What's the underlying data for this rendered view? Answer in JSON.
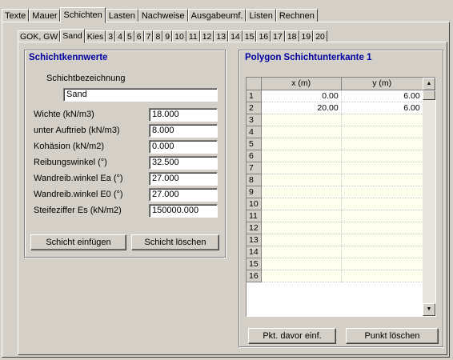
{
  "top_tabs": [
    "Texte",
    "Mauer",
    "Schichten",
    "Lasten",
    "Nachweise",
    "Ausgabeumf.",
    "Listen",
    "Rechnen"
  ],
  "top_active": "Schichten",
  "sub_tabs": [
    "GOK, GW",
    "Sand",
    "Kies",
    "3",
    "4",
    "5",
    "6",
    "7",
    "8",
    "9",
    "10",
    "11",
    "12",
    "13",
    "14",
    "15",
    "16",
    "17",
    "18",
    "19",
    "20"
  ],
  "sub_active": "Sand",
  "left": {
    "title": "Schichtkennwerte",
    "name_label": "Schichtbezeichnung",
    "name_value": "Sand",
    "fields": [
      {
        "label": "Wichte (kN/m3)",
        "value": "18.000"
      },
      {
        "label": "unter Auftrieb (kN/m3)",
        "value": "8.000"
      },
      {
        "label": "Kohäsion (kN/m2)",
        "value": "0.000"
      },
      {
        "label": "Reibungswinkel (°)",
        "value": "32.500"
      },
      {
        "label": "Wandreib.winkel Ea (°)",
        "value": "27.000"
      },
      {
        "label": "Wandreib.winkel E0 (°)",
        "value": "27.000"
      },
      {
        "label": "Steifeziffer Es (kN/m2)",
        "value": "150000.000"
      }
    ],
    "btn_insert": "Schicht einfügen",
    "btn_delete": "Schicht löschen"
  },
  "right": {
    "title": "Polygon Schichtunterkante 1",
    "col_x": "x (m)",
    "col_y": "y (m)",
    "rows": [
      {
        "n": "1",
        "x": "0.00",
        "y": "6.00"
      },
      {
        "n": "2",
        "x": "20.00",
        "y": "6.00"
      },
      {
        "n": "3",
        "x": "",
        "y": ""
      },
      {
        "n": "4",
        "x": "",
        "y": ""
      },
      {
        "n": "5",
        "x": "",
        "y": ""
      },
      {
        "n": "6",
        "x": "",
        "y": ""
      },
      {
        "n": "7",
        "x": "",
        "y": ""
      },
      {
        "n": "8",
        "x": "",
        "y": ""
      },
      {
        "n": "9",
        "x": "",
        "y": ""
      },
      {
        "n": "10",
        "x": "",
        "y": ""
      },
      {
        "n": "11",
        "x": "",
        "y": ""
      },
      {
        "n": "12",
        "x": "",
        "y": ""
      },
      {
        "n": "13",
        "x": "",
        "y": ""
      },
      {
        "n": "14",
        "x": "",
        "y": ""
      },
      {
        "n": "15",
        "x": "",
        "y": ""
      },
      {
        "n": "16",
        "x": "",
        "y": ""
      }
    ],
    "btn_before": "Pkt. davor einf.",
    "btn_delete": "Punkt löschen"
  },
  "icons": {
    "scroll_up": "arrow-up-icon",
    "scroll_down": "arrow-down-icon"
  }
}
